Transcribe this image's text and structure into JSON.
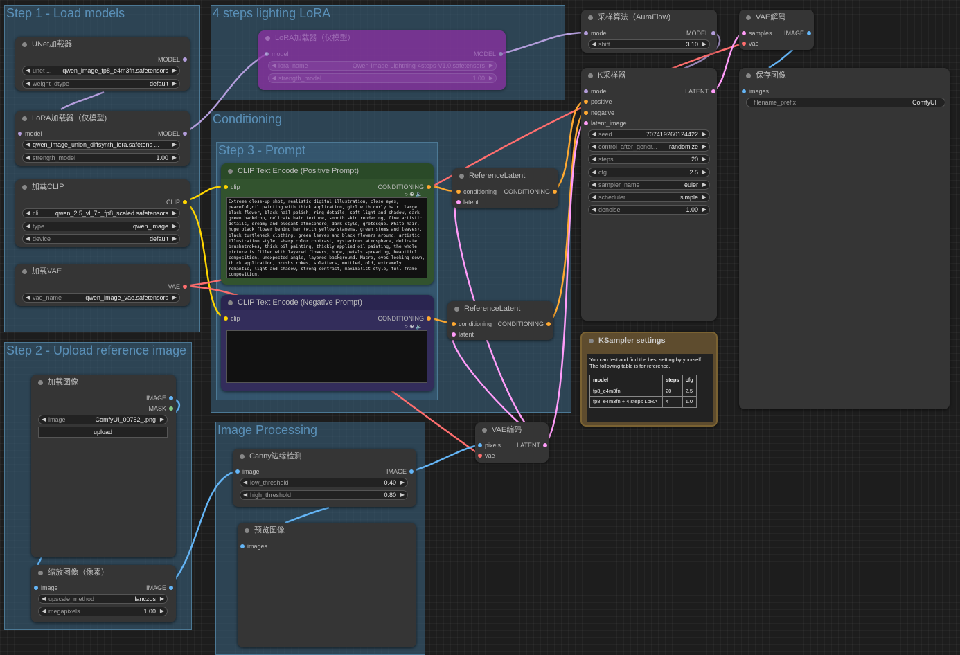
{
  "groups": {
    "load_models": "Step 1 - Load models",
    "lora4": "4 steps lighting LoRA",
    "conditioning": "Conditioning",
    "prompt": "Step 3 - Prompt",
    "upload": "Step 2 - Upload reference image",
    "processing": "Image Processing"
  },
  "unet": {
    "title": "UNet加载器",
    "out_model": "MODEL",
    "w1_label": "unet ...",
    "w1_value": "qwen_image_fp8_e4m3fn.safetensors",
    "w2_label": "weight_dtype",
    "w2_value": "default"
  },
  "lora_main": {
    "title": "LoRA加载器（仅模型)",
    "in_model": "model",
    "out_model": "MODEL",
    "w1_value": "qwen_image_union_diffsynth_lora.safetens ...",
    "w2_label": "strength_model",
    "w2_value": "1.00"
  },
  "lora_bypass": {
    "title": "LoRA加载器（仅模型）",
    "in_model": "model",
    "out_model": "MODEL",
    "w1_label": "lora_name",
    "w1_value": "Qwen-Image-Lightning-4steps-V1.0.safetensors",
    "w2_label": "strength_model",
    "w2_value": "1.00"
  },
  "clip_loader": {
    "title": "加载CLIP",
    "out_clip": "CLIP",
    "w1_label": "cli...",
    "w1_value": "qwen_2.5_vl_7b_fp8_scaled.safetensors",
    "w2_label": "type",
    "w2_value": "qwen_image",
    "w3_label": "device",
    "w3_value": "default"
  },
  "vae_loader": {
    "title": "加载VAE",
    "out_vae": "VAE",
    "w1_label": "vae_name",
    "w1_value": "qwen_image_vae.safetensors"
  },
  "positive": {
    "title": "CLIP Text Encode (Positive Prompt)",
    "in_clip": "clip",
    "out": "CONDITIONING",
    "text": "Extreme close-up shot, realistic digital illustration, close eyes, peaceful,oil painting with thick application, girl with curly hair, large black flower, black nail polish, ring details, soft light and shadow, dark green backdrop, delicate hair texture, smooth skin rendering, fine artistic details, dreamy and elegant atmosphere, dark style, grotesque. White hair, huge black flower behind her (with yellow stamens, green stems and leaves), black turtleneck clothing, green leaves and black flowers around, artistic illustration style, sharp color contrast, mysterious atmosphere, delicate brushstrokes, thick oil painting, thickly applied oil painting, the whole picture is filled with layered flowers, huge, petals spreading, beautiful composition, unexpected angle, layered background. Macro, eyes looking down, thick application, brushstrokes, splatters, mottled, old, extremely romantic, light and shadow, strong contrast, maximalist style, full-frame composition."
  },
  "negative": {
    "title": "CLIP Text Encode (Negative Prompt)",
    "in_clip": "clip",
    "out": "CONDITIONING",
    "text": ""
  },
  "reflat1": {
    "title": "ReferenceLatent",
    "in_cond": "conditioning",
    "out": "CONDITIONING",
    "in_latent": "latent"
  },
  "reflat2": {
    "title": "ReferenceLatent",
    "in_cond": "conditioning",
    "out": "CONDITIONING",
    "in_latent": "latent"
  },
  "aura": {
    "title": "采样算法（AuraFlow)",
    "in_model": "model",
    "out_model": "MODEL",
    "w1_label": "shift",
    "w1_value": "3.10"
  },
  "ksampler": {
    "title": "K采样器",
    "in_model": "model",
    "in_pos": "positive",
    "in_neg": "negative",
    "in_latent": "latent_image",
    "out": "LATENT",
    "widgets": [
      {
        "label": "seed",
        "value": "707419260124422"
      },
      {
        "label": "control_after_gener...",
        "value": "randomize"
      },
      {
        "label": "steps",
        "value": "20"
      },
      {
        "label": "cfg",
        "value": "2.5"
      },
      {
        "label": "sampler_name",
        "value": "euler"
      },
      {
        "label": "scheduler",
        "value": "simple"
      },
      {
        "label": "denoise",
        "value": "1.00"
      }
    ]
  },
  "vae_decode": {
    "title": "VAE解码",
    "in_samples": "samples",
    "in_vae": "vae",
    "out": "IMAGE"
  },
  "save_image": {
    "title": "保存图像",
    "in_images": "images",
    "w1_label": "filename_prefix",
    "w1_value": "ComfyUI"
  },
  "note": {
    "title": "KSampler settings",
    "line1": "You can test and find the best setting by yourself.",
    "line2": "The following table is for reference.",
    "headers": [
      "model",
      "steps",
      "cfg"
    ],
    "rows": [
      [
        "fp8_e4m3fn",
        "20",
        "2.5"
      ],
      [
        "fp8_e4m3fn + 4 steps LoRA",
        "4",
        "1.0"
      ]
    ]
  },
  "load_image": {
    "title": "加载图像",
    "out_image": "IMAGE",
    "out_mask": "MASK",
    "w1_label": "image",
    "w1_value": "ComfyUI_00752_.png",
    "upload": "upload"
  },
  "scale_image": {
    "title": "缩放图像（像素）",
    "in_image": "image",
    "out": "IMAGE",
    "w1_label": "upscale_method",
    "w1_value": "lanczos",
    "w2_label": "megapixels",
    "w2_value": "1.00"
  },
  "canny": {
    "title": "Canny边缘检测",
    "in_image": "image",
    "out": "IMAGE",
    "w1_label": "low_threshold",
    "w1_value": "0.40",
    "w2_label": "high_threshold",
    "w2_value": "0.80"
  },
  "preview": {
    "title": "预览图像",
    "in_images": "images"
  },
  "vae_encode": {
    "title": "VAE编码",
    "in_pixels": "pixels",
    "in_vae": "vae",
    "out": "LATENT"
  },
  "colors": {
    "model": "#b39ddb",
    "clip": "#ffd500",
    "vae": "#ff6e6e",
    "conditioning": "#ffa931",
    "latent": "#ff9cf9",
    "image": "#64b5f6",
    "mask": "#81c784"
  }
}
